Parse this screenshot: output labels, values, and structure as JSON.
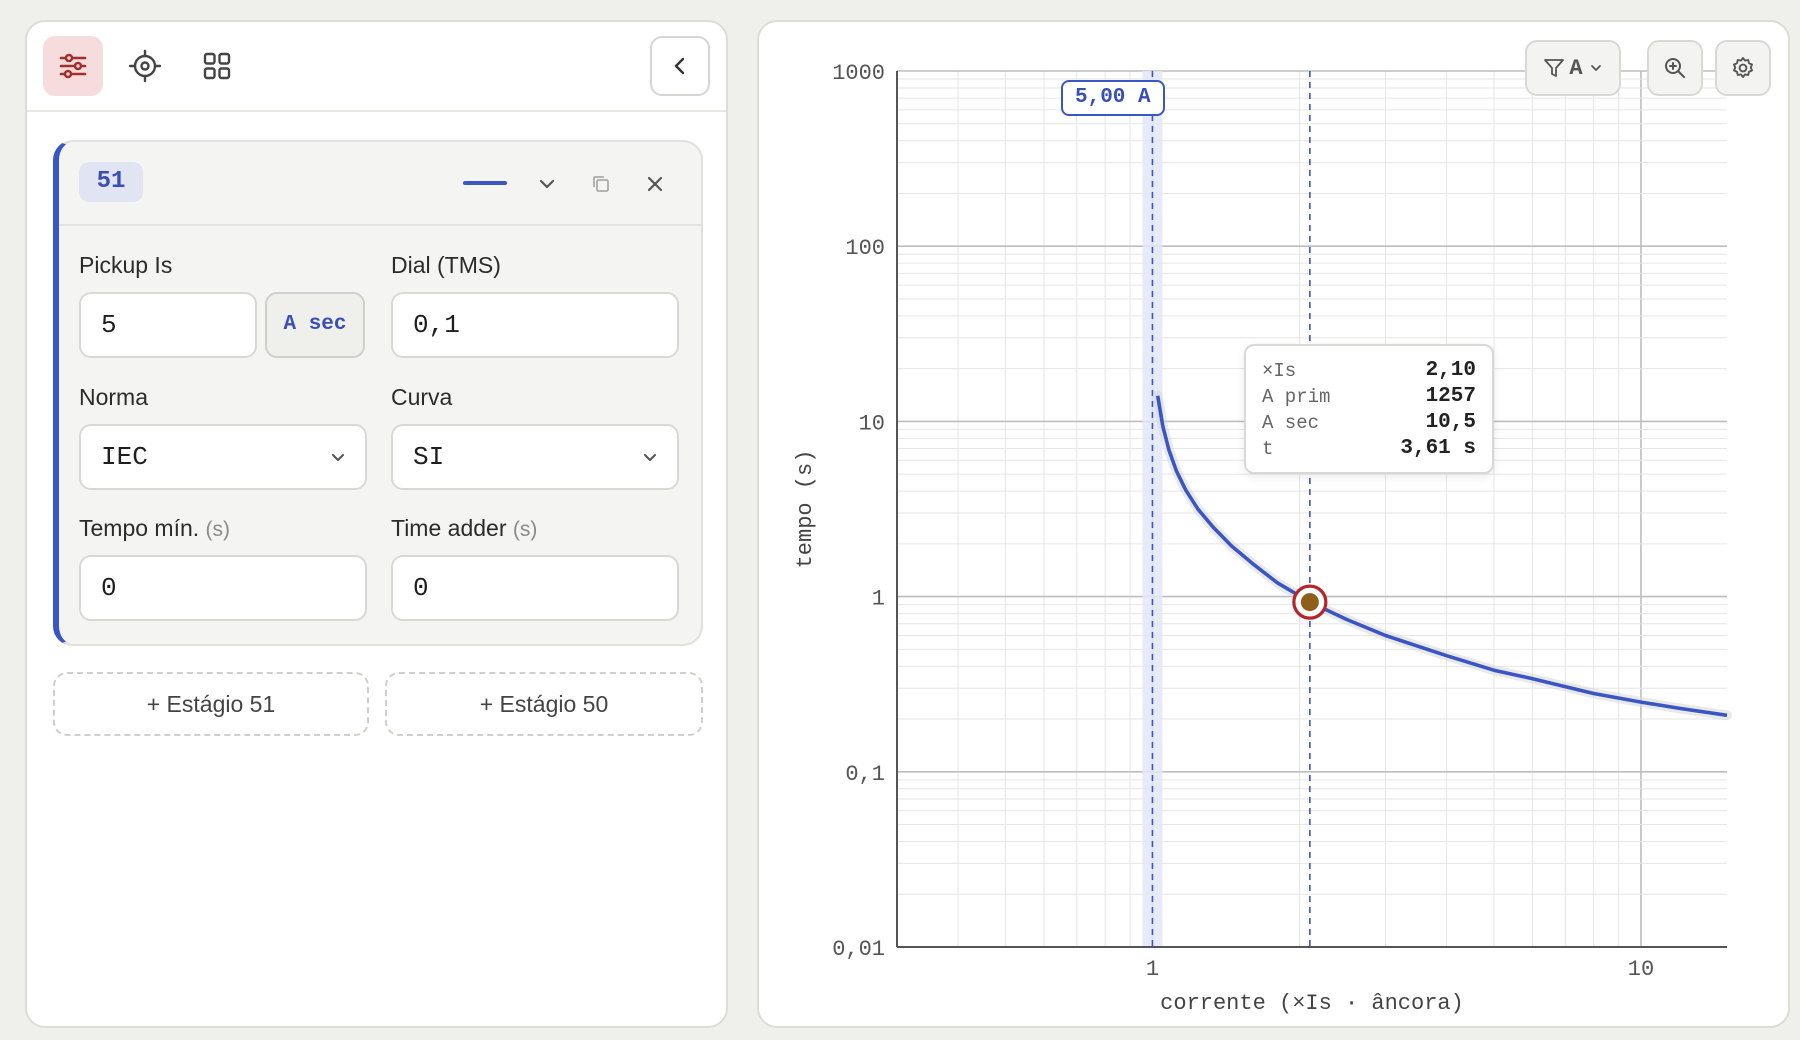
{
  "toolbar": {
    "tabs": [
      {
        "icon": "sliders-icon",
        "active": true
      },
      {
        "icon": "target-icon",
        "active": false
      },
      {
        "icon": "grid-icon",
        "active": false
      }
    ],
    "collapse_icon": "chevron-left-icon"
  },
  "stage": {
    "badge": "51",
    "line_color": "#3a55c4",
    "fields": {
      "pickup": {
        "label": "Pickup Is",
        "value": "5",
        "unit_button": "A sec"
      },
      "dial": {
        "label": "Dial (TMS)",
        "value": "0,1"
      },
      "norma": {
        "label": "Norma",
        "value": "IEC"
      },
      "curva": {
        "label": "Curva",
        "value": "SI"
      },
      "tempo_min": {
        "label": "Tempo mín.",
        "unit": "(s)",
        "value": "0"
      },
      "time_adder": {
        "label": "Time adder",
        "unit": "(s)",
        "value": "0"
      }
    }
  },
  "actions": {
    "add_51": "+ Estágio 51",
    "add_50": "+ Estágio 50"
  },
  "chart_controls": {
    "phase_filter": "A"
  },
  "tooltip": {
    "rows": [
      {
        "key": "×Is",
        "value": "2,10"
      },
      {
        "key": "A prim",
        "value": "1257"
      },
      {
        "key": "A sec",
        "value": "10,5"
      },
      {
        "key": "t",
        "value": "3,61 s"
      }
    ]
  },
  "chart_data": {
    "type": "line",
    "xscale": "log",
    "yscale": "log",
    "xlim": [
      0.3,
      15
    ],
    "ylim": [
      0.01,
      1000
    ],
    "xlabel": "corrente (×Is · âncora)",
    "ylabel": "tempo (s)",
    "xticks": [
      {
        "value": 1,
        "label": "1"
      },
      {
        "value": 10,
        "label": "10"
      }
    ],
    "yticks": [
      {
        "value": 1000,
        "label": "1000"
      },
      {
        "value": 100,
        "label": "100"
      },
      {
        "value": 10,
        "label": "10"
      },
      {
        "value": 1,
        "label": "1"
      },
      {
        "value": 0.1,
        "label": "0,1"
      },
      {
        "value": 0.01,
        "label": "0,01"
      }
    ],
    "grid": true,
    "pickup_marker": {
      "x": 1,
      "label": "5,00 A"
    },
    "cursor_x": 2.1,
    "marker_point": {
      "x": 2.1,
      "y": 0.93
    },
    "series": [
      {
        "color": "#3a55c4",
        "x": [
          1.025,
          1.05,
          1.08,
          1.12,
          1.17,
          1.24,
          1.33,
          1.45,
          1.6,
          1.8,
          2.1,
          2.5,
          3,
          4,
          5,
          6,
          8,
          10,
          12,
          15
        ],
        "y": [
          14.0,
          9.4,
          6.9,
          5.2,
          4.05,
          3.15,
          2.5,
          1.95,
          1.55,
          1.2,
          0.93,
          0.74,
          0.6,
          0.46,
          0.38,
          0.34,
          0.28,
          0.25,
          0.23,
          0.21
        ]
      }
    ]
  }
}
